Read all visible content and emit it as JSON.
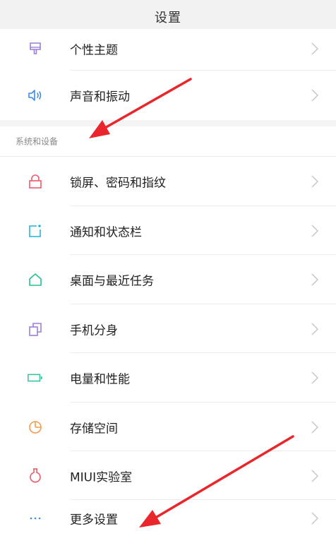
{
  "header": {
    "title": "设置"
  },
  "section_personal": {
    "items": [
      {
        "label": "个性主题",
        "icon": "theme-brush-icon",
        "color": "#9b7fd8"
      },
      {
        "label": "声音和振动",
        "icon": "speaker-icon",
        "color": "#3a8ee6"
      }
    ]
  },
  "section_system": {
    "title": "系统和设备",
    "items": [
      {
        "label": "锁屏、密码和指纹",
        "icon": "lock-icon",
        "color": "#f05a6a"
      },
      {
        "label": "通知和状态栏",
        "icon": "notification-icon",
        "color": "#1fb6d9"
      },
      {
        "label": "桌面与最近任务",
        "icon": "home-icon",
        "color": "#27c08a"
      },
      {
        "label": "手机分身",
        "icon": "second-space-icon",
        "color": "#9b7fd8"
      },
      {
        "label": "电量和性能",
        "icon": "battery-icon",
        "color": "#2fbf9a"
      },
      {
        "label": "存储空间",
        "icon": "storage-pie-icon",
        "color": "#f59b4a"
      },
      {
        "label": "MIUI实验室",
        "icon": "flask-icon",
        "color": "#f05a6a"
      },
      {
        "label": "更多设置",
        "icon": "more-dots-icon",
        "color": "#3a8ee6"
      }
    ]
  },
  "colors": {
    "annotation_arrow": "#e8262b",
    "chevron": "#c4c4c4",
    "header_bg": "#f2f2f2"
  }
}
